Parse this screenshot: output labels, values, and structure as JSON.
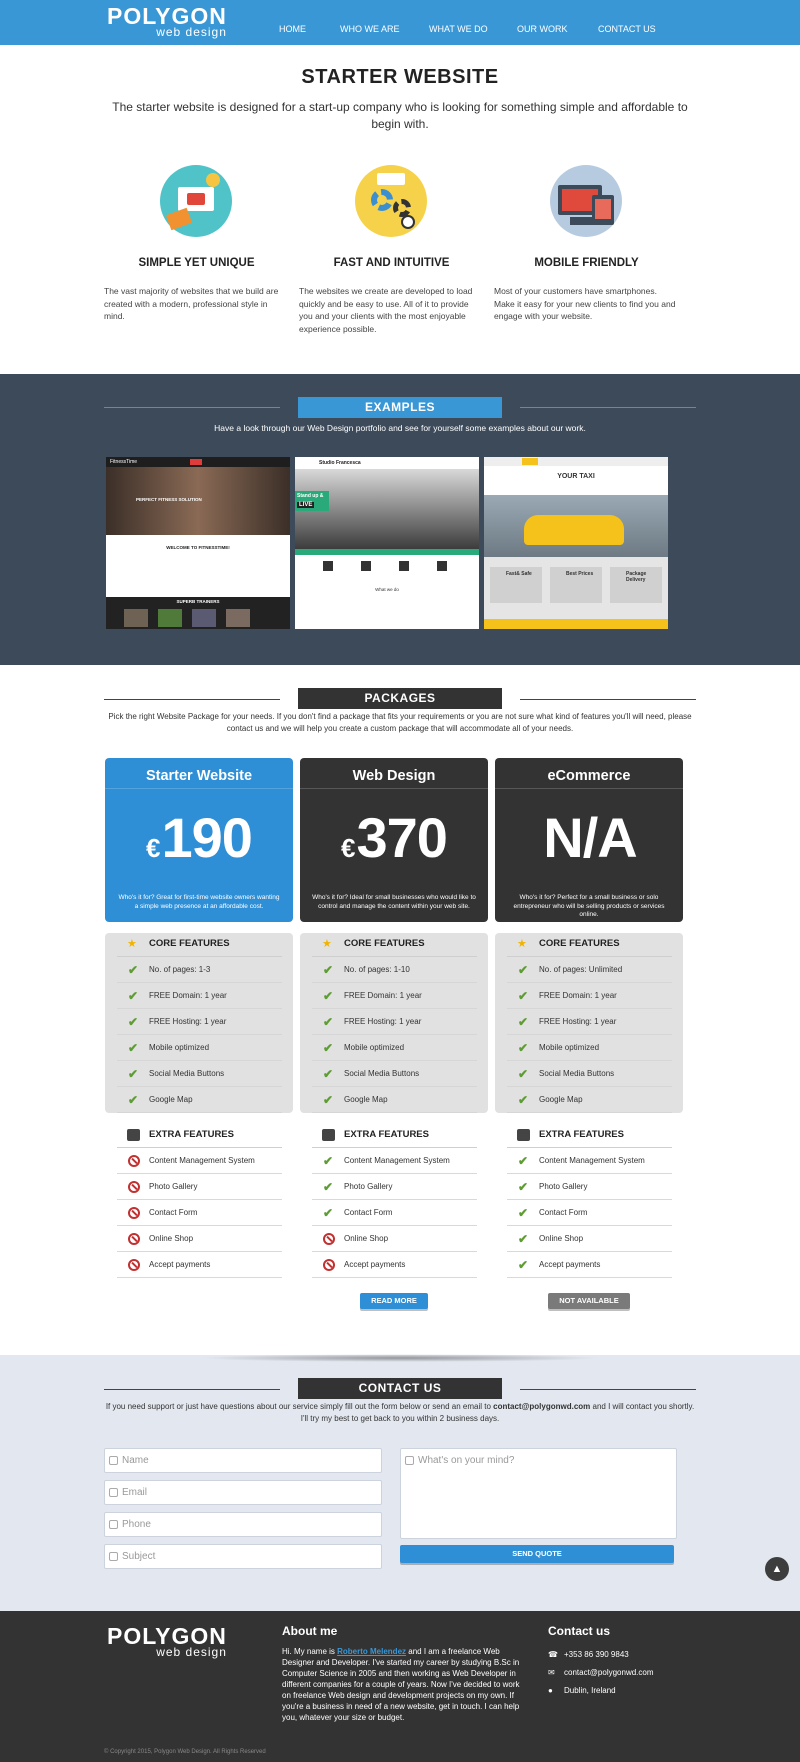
{
  "nav": {
    "logo_main": "POLYGON",
    "logo_sub": "web design",
    "items": [
      "HOME",
      "WHO WE ARE",
      "WHAT WE DO",
      "OUR WORK",
      "CONTACT US"
    ]
  },
  "starter": {
    "title": "STARTER WEBSITE",
    "intro": "The starter website is designed for a start-up company who is looking for something simple and affordable to begin with.",
    "features": [
      {
        "title": "SIMPLE YET UNIQUE",
        "text": "The vast majority of websites that we build are created with a modern, professional style in mind."
      },
      {
        "title": "FAST AND INTUITIVE",
        "text": "The websites we create are developed to load quickly and be easy to use. All of it to provide you and your clients with the most enjoyable experience possible."
      },
      {
        "title": "MOBILE FRIENDLY",
        "text": "Most of your customers have smartphones. Make it easy for your new clients to find you and engage with your website."
      }
    ]
  },
  "examples": {
    "heading": "EXAMPLES",
    "intro": "Have a look through our Web Design portfolio and see for yourself some examples about our work.",
    "shots": [
      {
        "brand": "FitnessTime",
        "badge": "PERFECT FITNESS SOLUTION",
        "welcome": "WELCOME TO FITNESSTIME!",
        "section": "SUPERB TRAINERS"
      },
      {
        "brand": "Studio Francesca",
        "badge": "Stand up &",
        "badge2": "LIVE",
        "section": "What we do"
      },
      {
        "brand": "YOUR TAXI",
        "tile1": "Fast& Safe",
        "tile2": "Best Prices",
        "tile3": "Package Delivery"
      }
    ]
  },
  "packages": {
    "heading": "PACKAGES",
    "intro": "Pick the right Website Package for your needs. If you don't find a package that fits your requirements or you are not sure what kind of features you'll will need, please contact us and we will help you create a custom package that will accommodate all of your needs.",
    "plans": [
      {
        "name": "Starter Website",
        "currency": "€",
        "amount": "190",
        "who": "Who's it for? Great for first-time website owners wanting a simple web presence at an affordable cost.",
        "color": "#2f8fd6",
        "button": "READ MORE"
      },
      {
        "name": "Web Design",
        "currency": "€",
        "amount": "370",
        "who": "Who's it for? Ideal for small businesses who would like to control and manage the content within your web site.",
        "color": "#333333",
        "button": ""
      },
      {
        "name": "eCommerce",
        "currency": "",
        "amount": "N/A",
        "who": "Who's it for? Perfect for a small business or solo entrepreneur who will be selling products or services online.",
        "color": "#333333",
        "button": "NOT AVAILABLE"
      }
    ],
    "core_heading": "CORE FEATURES",
    "extra_heading": "EXTRA FEATURES",
    "core": [
      [
        "No. of pages: 1-3",
        "FREE Domain: 1 year",
        "FREE Hosting: 1 year",
        "Mobile optimized",
        "Social Media Buttons",
        "Google Map"
      ],
      [
        "No. of pages: 1-10",
        "FREE Domain: 1 year",
        "FREE Hosting: 1 year",
        "Mobile optimized",
        "Social Media Buttons",
        "Google Map"
      ],
      [
        "No. of pages: Unlimited",
        "FREE Domain: 1 year",
        "FREE Hosting: 1 year",
        "Mobile optimized",
        "Social Media Buttons",
        "Google Map"
      ]
    ],
    "extra_labels": [
      "Content Management System",
      "Photo Gallery",
      "Contact Form",
      "Online Shop",
      "Accept payments"
    ],
    "extra_included": [
      [
        false,
        false,
        false,
        false,
        false
      ],
      [
        true,
        true,
        true,
        false,
        false
      ],
      [
        true,
        true,
        true,
        true,
        true
      ]
    ]
  },
  "contact": {
    "heading": "CONTACT US",
    "intro_pre": "If you need support or just have questions about our service simply fill out the form below or send an email to ",
    "email": "contact@polygonwd.com",
    "intro_post": " and I will contact you shortly. I'll try my best to get back to you within 2 business days.",
    "placeholders": {
      "name": "Name",
      "email": "Email",
      "phone": "Phone",
      "subject": "Subject",
      "message": "What's on your mind?"
    },
    "send": "SEND QUOTE"
  },
  "footer": {
    "about_title": "About me",
    "about_pre": "Hi. My name is ",
    "about_name": "Roberto Melendez",
    "about_post": " and I am a freelance Web Designer and Developer. I've started my career by studying B.Sc in Computer Science in 2005 and then working as Web Developer in different companies for a couple of years. Now I've decided to work on freelance Web design and development projects on my own. If you're a business in need of a new website, get in touch. I can help you, whatever your size or budget.",
    "contact_title": "Contact us",
    "phone": "+353 86 390 9843",
    "email": "contact@polygonwd.com",
    "location": "Dublin, Ireland",
    "copyright": "© Copyright 2015, Polygon Web Design. All Rights Reserved"
  }
}
